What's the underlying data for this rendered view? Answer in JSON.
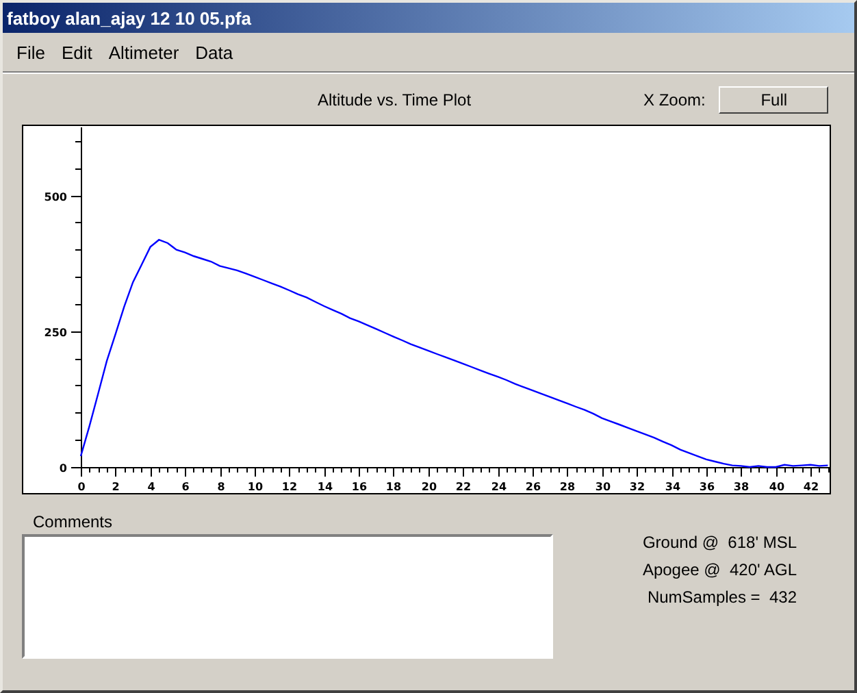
{
  "window": {
    "title": "fatboy alan_ajay 12 10 05.pfa"
  },
  "menu": [
    {
      "label": "File"
    },
    {
      "label": "Edit"
    },
    {
      "label": "Altimeter"
    },
    {
      "label": "Data"
    }
  ],
  "plot": {
    "title": "Altitude vs. Time Plot",
    "zoom_label": "X Zoom:",
    "zoom_button": "Full",
    "chart_data": {
      "type": "line",
      "xlim": [
        0,
        43.1
      ],
      "ylim": [
        0,
        625
      ],
      "xticks": [
        0,
        2,
        4,
        6,
        8,
        10,
        12,
        14,
        16,
        18,
        20,
        22,
        24,
        26,
        28,
        30,
        32,
        34,
        36,
        38,
        40,
        42
      ],
      "yticks": [
        0,
        250,
        500
      ],
      "x": [
        0,
        0.5,
        1,
        1.5,
        2,
        2.5,
        3,
        3.5,
        4,
        4.5,
        5,
        5.5,
        6,
        6.5,
        7,
        7.5,
        8,
        8.5,
        9,
        9.5,
        10,
        10.5,
        11,
        11.5,
        12,
        12.5,
        13,
        13.5,
        14,
        14.5,
        15,
        15.5,
        16,
        16.5,
        17,
        17.5,
        18,
        18.5,
        19,
        19.5,
        20,
        20.5,
        21,
        21.5,
        22,
        22.5,
        23,
        23.5,
        24,
        24.5,
        25,
        25.5,
        26,
        26.5,
        27,
        27.5,
        28,
        28.5,
        29,
        29.5,
        30,
        30.5,
        31,
        31.5,
        32,
        32.5,
        33,
        33.5,
        34,
        34.5,
        35,
        35.5,
        36,
        36.5,
        37,
        37.5,
        38,
        38.5,
        39,
        39.5,
        40,
        40.5,
        41,
        41.5,
        42,
        42.5,
        43
      ],
      "series": [
        {
          "color": "#0000ff",
          "values": [
            20,
            75,
            135,
            195,
            245,
            295,
            340,
            372,
            405,
            418,
            412,
            400,
            395,
            388,
            383,
            378,
            370,
            366,
            362,
            356,
            350,
            344,
            338,
            332,
            325,
            318,
            312,
            304,
            296,
            289,
            282,
            274,
            268,
            261,
            254,
            247,
            240,
            233,
            226,
            220,
            214,
            208,
            202,
            196,
            190,
            184,
            178,
            172,
            166,
            160,
            153,
            147,
            141,
            135,
            129,
            123,
            117,
            111,
            105,
            98,
            90,
            84,
            78,
            72,
            66,
            60,
            54,
            47,
            40,
            32,
            26,
            20,
            14,
            10,
            6,
            3,
            2,
            0,
            2,
            0,
            0,
            4,
            2,
            3,
            4,
            2,
            3
          ]
        }
      ]
    }
  },
  "comments": {
    "label": "Comments"
  },
  "stats": [
    {
      "text": "Ground @  618' MSL"
    },
    {
      "text": "Apogee @  420' AGL"
    },
    {
      "text": "NumSamples =  432"
    }
  ]
}
